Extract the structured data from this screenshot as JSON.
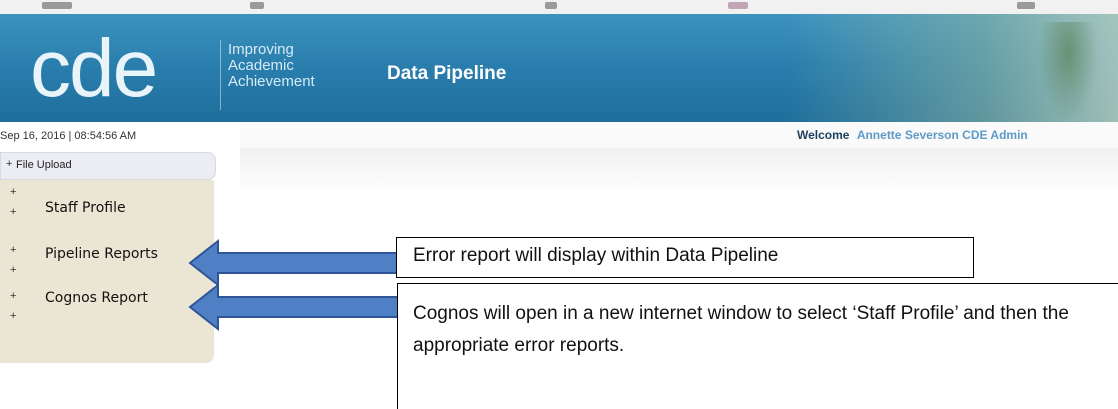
{
  "banner": {
    "logo": "cde",
    "tagline": [
      "Improving",
      "Academic",
      "Achievement"
    ],
    "product_title": "Data Pipeline"
  },
  "header": {
    "datetime": "Sep 16, 2016 | 08:54:56 AM",
    "welcome_label": "Welcome",
    "user_name": "Annette Severson CDE Admin"
  },
  "nav": {
    "section_label": "File Upload",
    "items": [
      {
        "label": "Staff Profile"
      },
      {
        "label": "Pipeline Reports"
      },
      {
        "label": "Cognos Report"
      }
    ]
  },
  "callouts": {
    "pipeline_reports": "Error report will display within Data Pipeline",
    "cognos_report": "Cognos will open in a new internet window to select ‘Staff Profile’ and then the appropriate error reports."
  },
  "icons": {
    "arrow": "left-arrow-icon",
    "expand": "plus-icon"
  },
  "colors": {
    "banner": "#2a7fae",
    "arrow_fill": "#4f7fc4",
    "arrow_stroke": "#2f5597",
    "nav_body": "#ebe6d3",
    "welcome_name": "#5d9bc7"
  }
}
